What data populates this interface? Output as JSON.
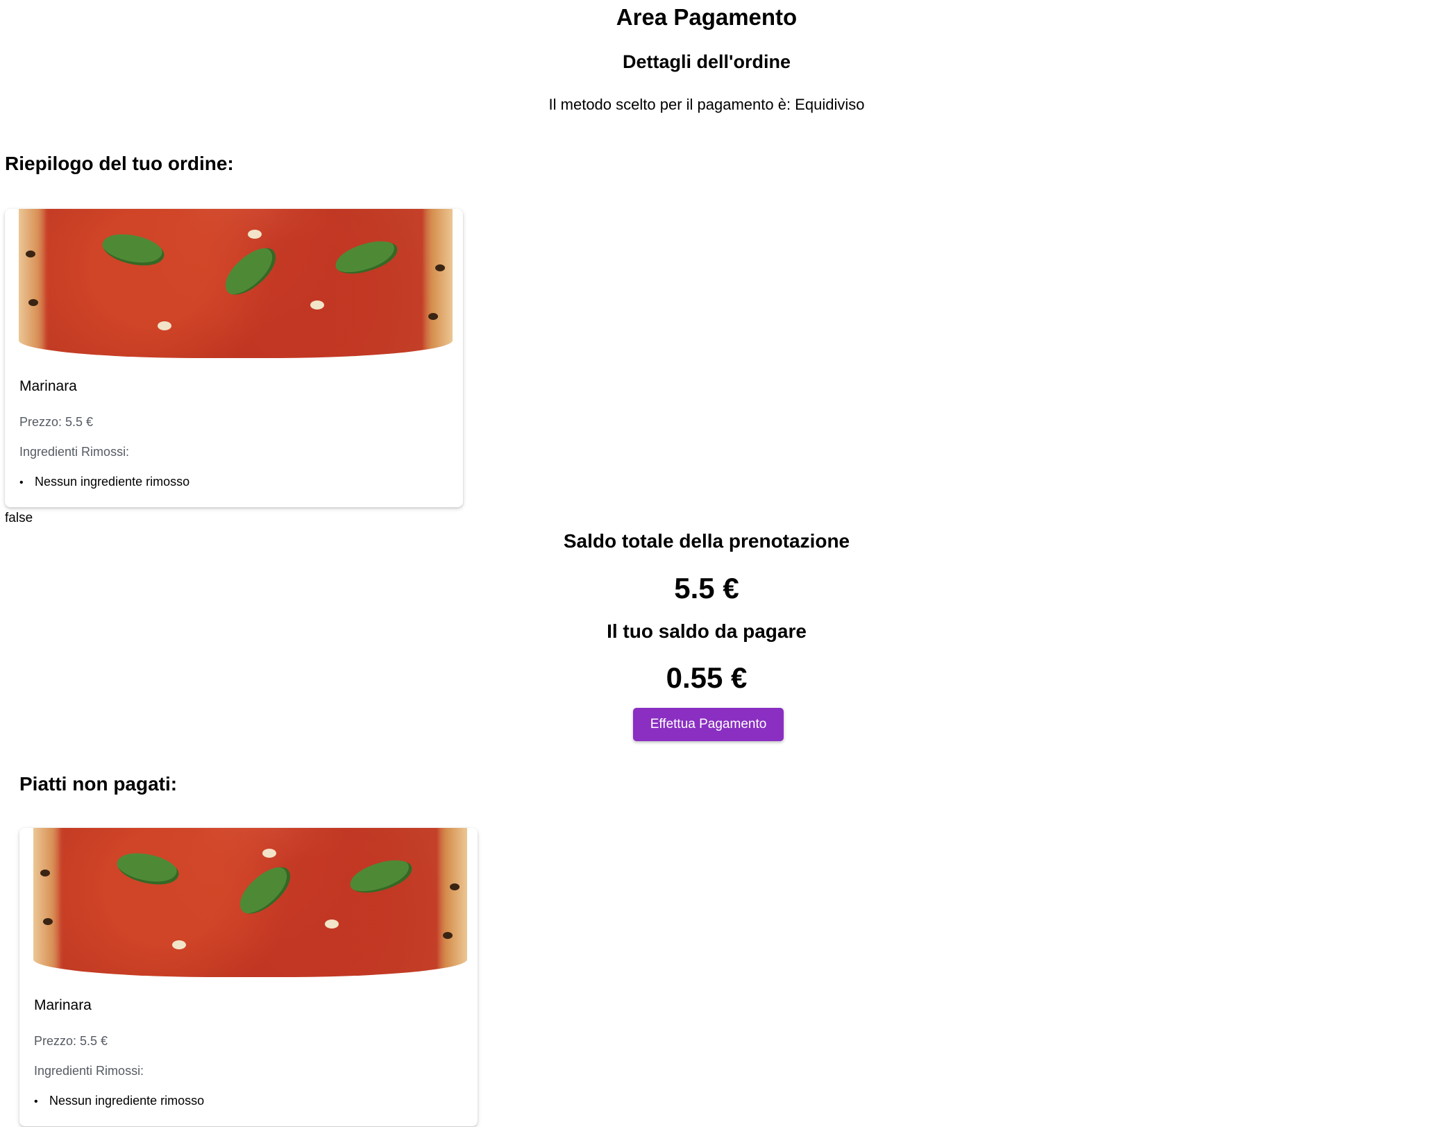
{
  "page": {
    "title": "Area Pagamento",
    "order_details_title": "Dettagli dell'ordine",
    "payment_method_text": "Il metodo scelto per il pagamento è: Equidiviso"
  },
  "summary": {
    "heading": "Riepilogo del tuo ordine:",
    "items": [
      {
        "name": "Marinara",
        "price": "Prezzo: 5.5 €",
        "removed_label": "Ingredienti Rimossi:",
        "removed_ingredients": [
          "Nessun ingrediente rimosso"
        ]
      }
    ]
  },
  "debug_flag": "false",
  "totals": {
    "total_label": "Saldo totale della prenotazione",
    "total_value": "5.5 €",
    "due_label": "Il tuo saldo da pagare",
    "due_value": "0.55 €"
  },
  "actions": {
    "pay_button_label": "Effettua Pagamento",
    "pay_button_color": "#8a2fc2"
  },
  "unpaid": {
    "heading": "Piatti non pagati:",
    "items": [
      {
        "name": "Marinara",
        "price": "Prezzo: 5.5 €",
        "removed_label": "Ingredienti Rimossi:",
        "removed_ingredients": [
          "Nessun ingrediente rimosso"
        ]
      }
    ]
  }
}
